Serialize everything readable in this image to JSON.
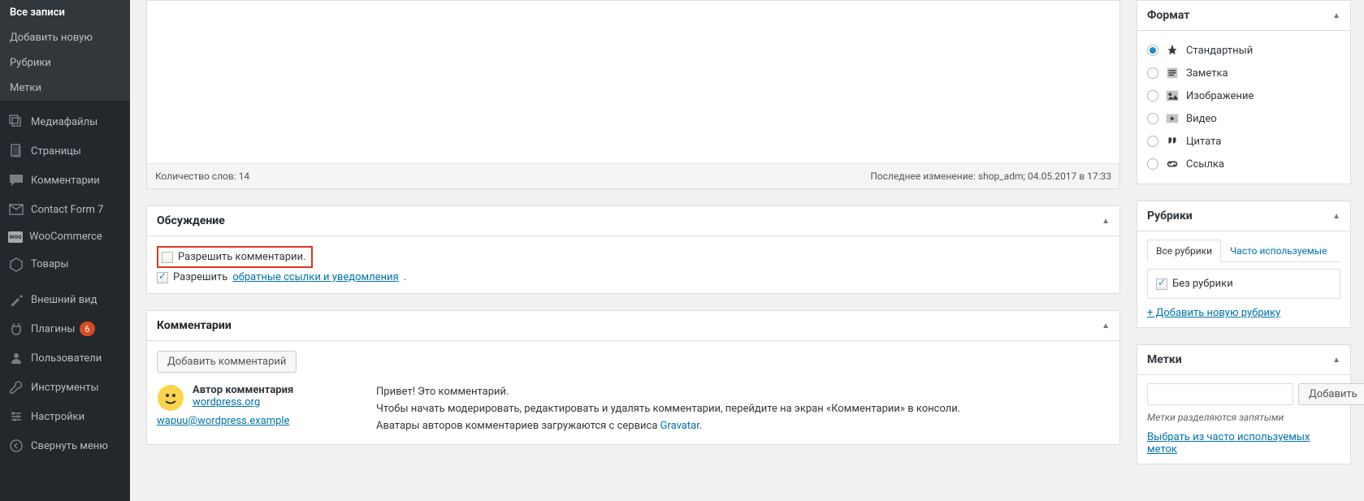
{
  "sidebar": {
    "posts_submenu": [
      {
        "label": "Все записи",
        "active": true
      },
      {
        "label": "Добавить новую",
        "active": false
      },
      {
        "label": "Рубрики",
        "active": false
      },
      {
        "label": "Метки",
        "active": false
      }
    ],
    "items": [
      {
        "label": "Медиафайлы"
      },
      {
        "label": "Страницы"
      },
      {
        "label": "Комментарии"
      },
      {
        "label": "Contact Form 7"
      },
      {
        "label": "WooCommerce"
      },
      {
        "label": "Товары"
      },
      {
        "label": "Внешний вид"
      },
      {
        "label": "Плагины",
        "badge": "6"
      },
      {
        "label": "Пользователи"
      },
      {
        "label": "Инструменты"
      },
      {
        "label": "Настройки"
      },
      {
        "label": "Свернуть меню"
      }
    ]
  },
  "editor": {
    "word_count": "Количество слов: 14",
    "last_edit": "Последнее изменение: shop_adm; 04.05.2017 в 17:33"
  },
  "discussion": {
    "title": "Обсуждение",
    "allow_comments": "Разрешить комментарии.",
    "allow_pings_prefix": "Разрешить ",
    "allow_pings_link": "обратные ссылки и уведомления"
  },
  "comments": {
    "title": "Комментарии",
    "add_button": "Добавить комментарий",
    "author_label": "Автор комментария",
    "author_site": "wordpress.org",
    "author_email": "wapuu@wordpress.example",
    "line1": "Привет! Это комментарий.",
    "line2": "Чтобы начать модерировать, редактировать и удалять комментарии, перейдите на экран «Комментарии» в консоли.",
    "line3_prefix": "Аватары авторов комментариев загружаются с сервиса ",
    "line3_link": "Gravatar"
  },
  "format": {
    "title": "Формат",
    "options": [
      {
        "label": "Стандартный",
        "checked": true
      },
      {
        "label": "Заметка"
      },
      {
        "label": "Изображение"
      },
      {
        "label": "Видео"
      },
      {
        "label": "Цитата"
      },
      {
        "label": "Ссылка"
      }
    ]
  },
  "categories": {
    "title": "Рубрики",
    "tab_all": "Все рубрики",
    "tab_used": "Часто используемые",
    "uncategorized": "Без рубрики",
    "add_link": "+ Добавить новую рубрику"
  },
  "tags": {
    "title": "Метки",
    "add_button": "Добавить",
    "hint": "Метки разделяются запятыми",
    "choose_link": "Выбрать из часто используемых меток"
  }
}
